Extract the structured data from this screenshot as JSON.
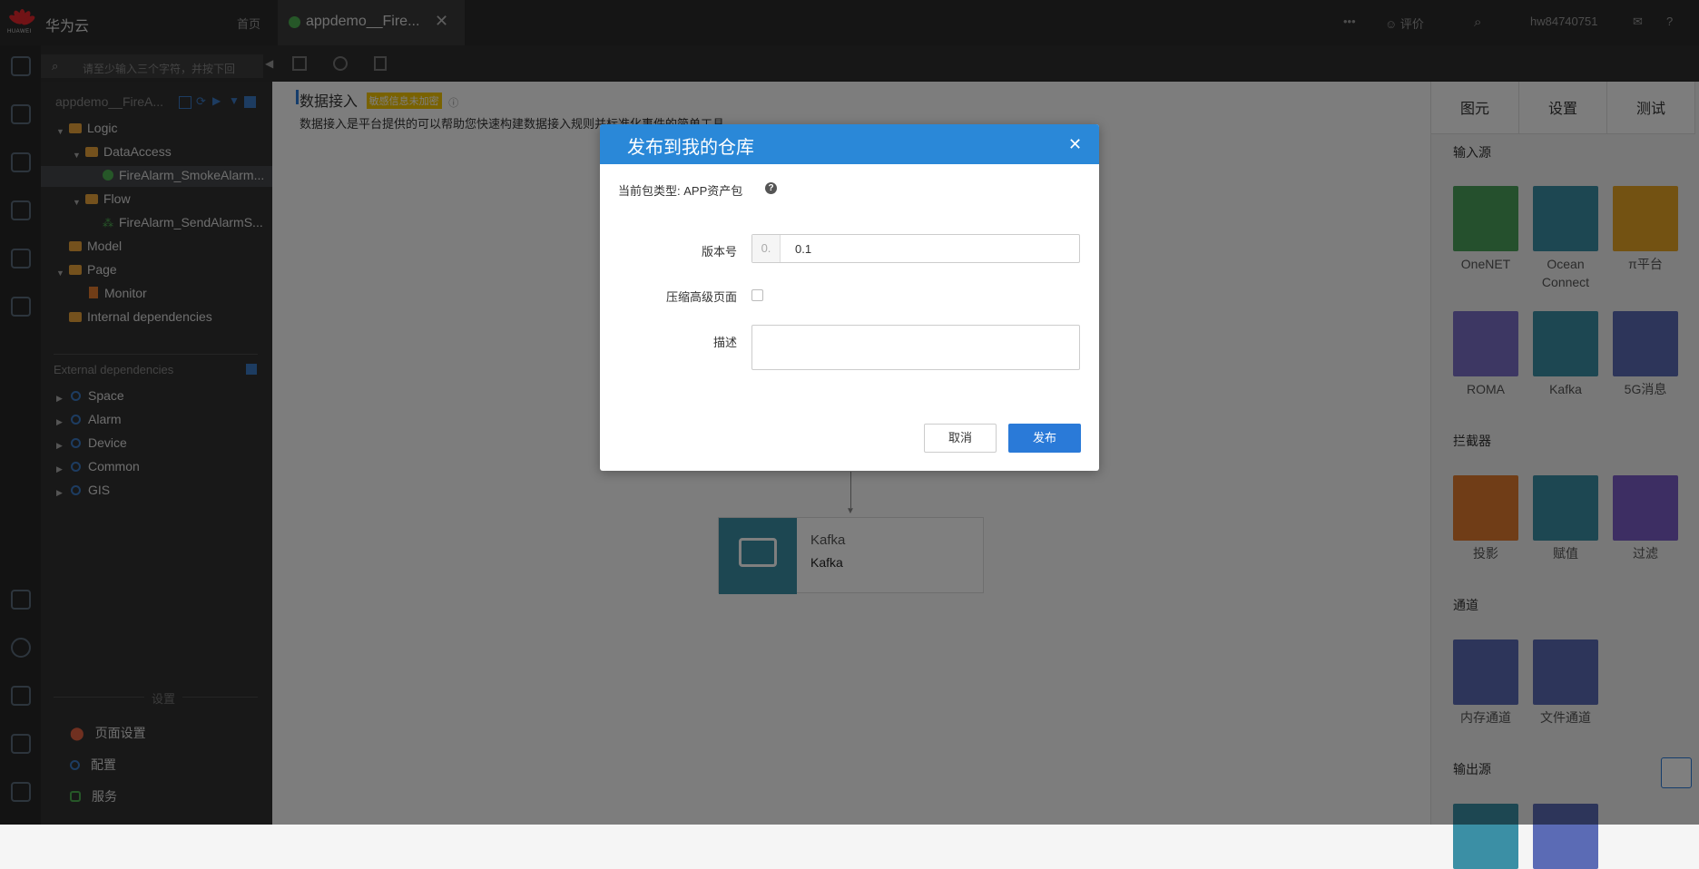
{
  "brand": {
    "name": "华为云",
    "logo_text": "HUAWEI"
  },
  "topbar": {
    "home": "首页",
    "tab_title": "appdemo__Fire...",
    "rate": "评价",
    "user": "hw84740751"
  },
  "search": {
    "placeholder": "请至少输入三个字符，并按下回"
  },
  "tree": {
    "app_name": "appdemo__FireA...",
    "nodes": {
      "logic": "Logic",
      "dataaccess": "DataAccess",
      "smoke": "FireAlarm_SmokeAlarm...",
      "flow": "Flow",
      "send": "FireAlarm_SendAlarmS...",
      "model": "Model",
      "page": "Page",
      "monitor": "Monitor",
      "internal": "Internal dependencies"
    },
    "external_title": "External dependencies",
    "external": [
      "Space",
      "Alarm",
      "Device",
      "Common",
      "GIS"
    ],
    "settings_title": "设置",
    "settings": [
      "页面设置",
      "配置",
      "服务"
    ]
  },
  "canvas": {
    "title": "数据接入",
    "badge": "敏感信息未加密",
    "desc": "数据接入是平台提供的可以帮助您快速构建数据接入规则并标准化事件的简单工具。",
    "node_type": "Kafka",
    "node_name": "Kafka"
  },
  "right_panel": {
    "tabs": [
      "图元",
      "设置",
      "测试"
    ],
    "sections": {
      "input": "输入源",
      "interceptor": "拦截器",
      "channel": "通道",
      "output": "输出源"
    },
    "input_tiles": [
      {
        "label": "OneNET",
        "color": "#4aa05a"
      },
      {
        "label": "Ocean Connect",
        "color": "#3b8fa5"
      },
      {
        "label": "π平台",
        "color": "#e6a425"
      },
      {
        "label": "ROMA",
        "color": "#7b6fc7"
      },
      {
        "label": "Kafka",
        "color": "#3b8fa5"
      },
      {
        "label": "5G消息",
        "color": "#5b6bb5"
      }
    ],
    "interceptor_tiles": [
      {
        "label": "投影",
        "color": "#e07a2e"
      },
      {
        "label": "赋值",
        "color": "#3b8fa5"
      },
      {
        "label": "过滤",
        "color": "#7b5cc7"
      }
    ],
    "channel_tiles": [
      {
        "label": "内存通道",
        "color": "#5b6bb5"
      },
      {
        "label": "文件通道",
        "color": "#5b6bb5"
      }
    ]
  },
  "modal": {
    "title": "发布到我的仓库",
    "package_type": "当前包类型: APP资产包",
    "version_label": "版本号",
    "version_prefix": "0.",
    "version_value": "0.1",
    "compress_label": "压缩高级页面",
    "desc_label": "描述",
    "cancel": "取消",
    "publish": "发布"
  }
}
